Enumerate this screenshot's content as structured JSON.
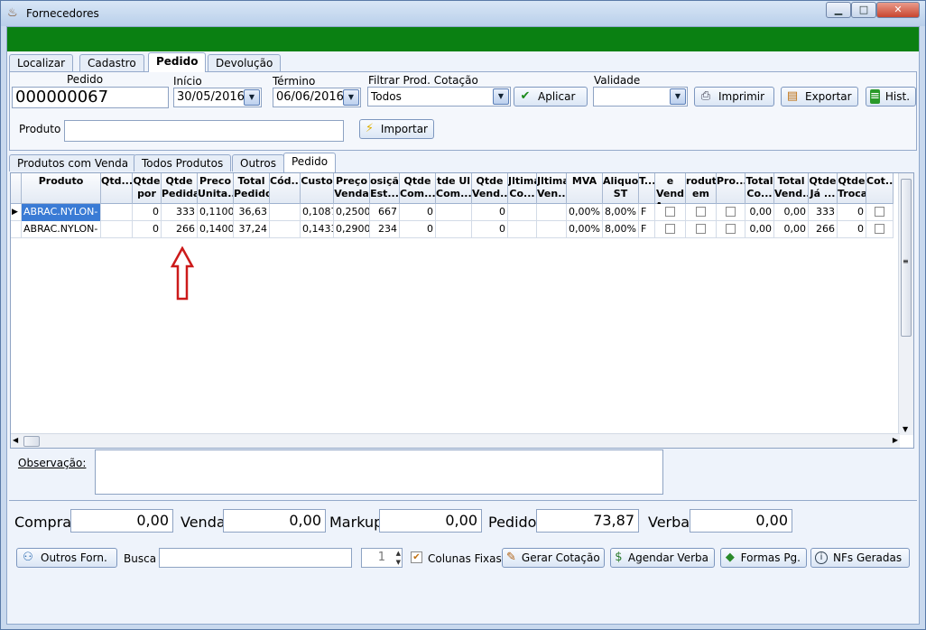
{
  "window": {
    "title": "Fornecedores",
    "min": "▁",
    "max": "□",
    "close": "✕"
  },
  "main_tabs": [
    "Localizar",
    "Cadastro",
    "Pedido",
    "Devolução"
  ],
  "pedido": {
    "pedido_label": "Pedido",
    "pedido_value": "000000067",
    "inicio_label": "Início",
    "inicio_value": "30/05/2016",
    "termino_label": "Término",
    "termino_value": "06/06/2016",
    "filtrar_label": "Filtrar Prod. Cotação",
    "filtrar_value": "Todos",
    "aplicar": "Aplicar",
    "validade_label": "Validade",
    "validade_value": "",
    "imprimir": "Imprimir",
    "exportar": "Exportar",
    "hist": "Hist.",
    "produto_label": "Produto",
    "produto_value": "",
    "importar": "Importar"
  },
  "sub_tabs": [
    "Produtos com Venda",
    "Todos Produtos",
    "Outros",
    "Pedido"
  ],
  "grid": {
    "columns": [
      "Produto",
      "Qtd...",
      "Qtde\npor ...",
      "Qtde\nPedida",
      "Preco\nUnita...",
      "Total\nPedido",
      "Cód...",
      "Custo",
      "Preço\nVenda",
      "osiçã\nEst...",
      "Qtde\nCom...",
      "tde Ul\nCom...",
      "Qtde\nVend...",
      "Jltima\nCo...",
      "Jltima\nVen...",
      "MVA",
      "Aliquota\nST",
      "T...",
      "e Vend\nApo...",
      "roduto\nem ...",
      "Pro...",
      "Total\nCo...",
      "Total\nVend...",
      "Qtde\nJá ...",
      "Qtde\nTroca",
      "Cot..."
    ],
    "rows": [
      [
        "ABRAC.NYLON-",
        "",
        "0",
        "333",
        "0,1100",
        "36,63",
        "",
        "0,1087",
        "0,2500",
        "667",
        "0",
        "",
        "0",
        "",
        "",
        "0,00%",
        "8,00%",
        "F",
        "",
        "",
        "",
        "0,00",
        "0,00",
        "333",
        "0",
        ""
      ],
      [
        "ABRAC.NYLON-",
        "",
        "0",
        "266",
        "0,1400",
        "37,24",
        "",
        "0,1433",
        "0,2900",
        "234",
        "0",
        "",
        "0",
        "",
        "",
        "0,00%",
        "8,00%",
        "F",
        "",
        "",
        "",
        "0,00",
        "0,00",
        "266",
        "0",
        ""
      ]
    ]
  },
  "observacao": {
    "label": "Observação:",
    "value": ""
  },
  "totais": {
    "compra_label": "Compra",
    "compra": "0,00",
    "venda_label": "Venda",
    "venda": "0,00",
    "markup_label": "Markup",
    "markup": "0,00",
    "pedido_label": "Pedido",
    "pedido": "73,87",
    "verba_label": "Verba",
    "verba": "0,00"
  },
  "bottom": {
    "outros_forn": "Outros Forn.",
    "busca_label": "Busca",
    "busca_value": "",
    "spin_value": "1",
    "colunas_fixas": "Colunas Fixas",
    "gerar_cotacao": "Gerar Cotação",
    "agendar_verba": "Agendar Verba",
    "formas_pg": "Formas Pg.",
    "nfs_geradas": "NFs Geradas"
  },
  "colors": {
    "green_bar": "#0a8012",
    "selection": "#3a7bd5",
    "arrow": "#cc1a1a"
  }
}
